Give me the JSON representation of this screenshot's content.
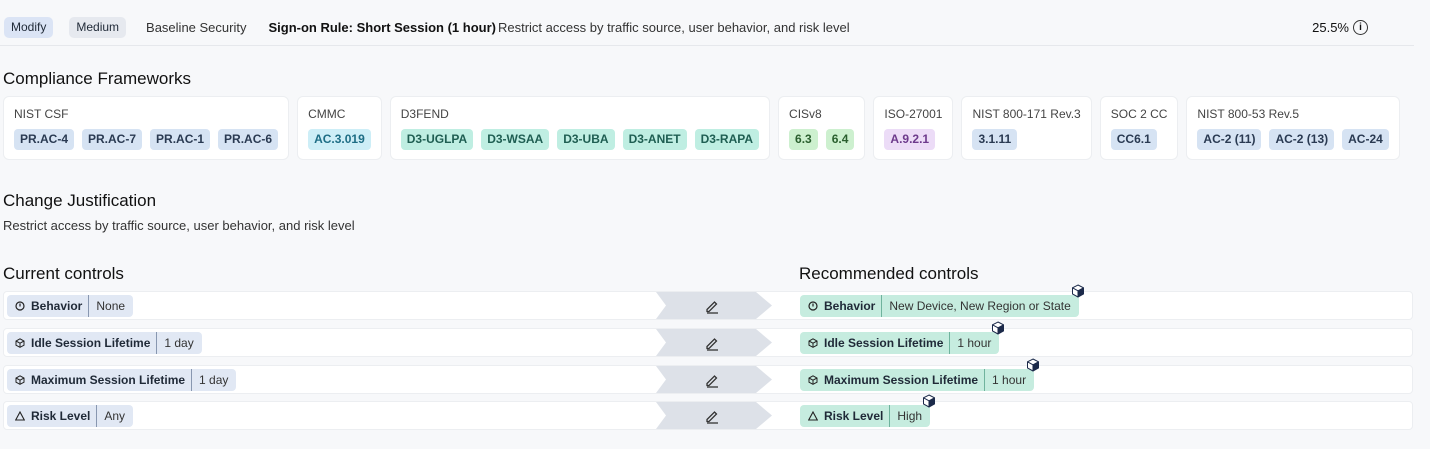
{
  "header": {
    "action_chip": "Modify",
    "severity_chip": "Medium",
    "category": "Baseline Security",
    "rule_title": "Sign-on Rule: Short Session (1 hour)",
    "rule_description": "Restrict access by traffic source, user behavior, and risk level",
    "score": "25.5%",
    "info_icon": "info-circle-icon"
  },
  "frameworks": {
    "title": "Compliance Frameworks",
    "cards": [
      {
        "name": "NIST CSF",
        "color": "blue",
        "tags": [
          "PR.AC-4",
          "PR.AC-7",
          "PR.AC-1",
          "PR.AC-6"
        ]
      },
      {
        "name": "CMMC",
        "color": "cyan",
        "tags": [
          "AC.3.019"
        ]
      },
      {
        "name": "D3FEND",
        "color": "teal",
        "tags": [
          "D3-UGLPA",
          "D3-WSAA",
          "D3-UBA",
          "D3-ANET",
          "D3-RAPA"
        ]
      },
      {
        "name": "CISv8",
        "color": "green",
        "tags": [
          "6.3",
          "6.4"
        ]
      },
      {
        "name": "ISO-27001",
        "color": "purple",
        "tags": [
          "A.9.2.1"
        ]
      },
      {
        "name": "NIST 800-171 Rev.3",
        "color": "blue",
        "tags": [
          "3.1.11"
        ]
      },
      {
        "name": "SOC 2 CC",
        "color": "blue",
        "tags": [
          "CC6.1"
        ]
      },
      {
        "name": "NIST 800-53 Rev.5",
        "color": "blue",
        "tags": [
          "AC-2 (11)",
          "AC-2 (13)",
          "AC-24"
        ]
      }
    ]
  },
  "justification": {
    "title": "Change Justification",
    "text": "Restrict access by traffic source, user behavior, and risk level"
  },
  "controls": {
    "current_title": "Current controls",
    "recommended_title": "Recommended controls",
    "rows": [
      {
        "icon": "behavior-icon",
        "label": "Behavior",
        "current": "None",
        "recommended": "New Device,  New Region or State"
      },
      {
        "icon": "cube-icon",
        "label": "Idle Session Lifetime",
        "current": "1 day",
        "recommended": "1 hour"
      },
      {
        "icon": "cube-icon",
        "label": "Maximum Session Lifetime",
        "current": "1 day",
        "recommended": "1 hour"
      },
      {
        "icon": "warning-triangle-icon",
        "label": "Risk Level",
        "current": "Any",
        "recommended": "High"
      }
    ]
  }
}
